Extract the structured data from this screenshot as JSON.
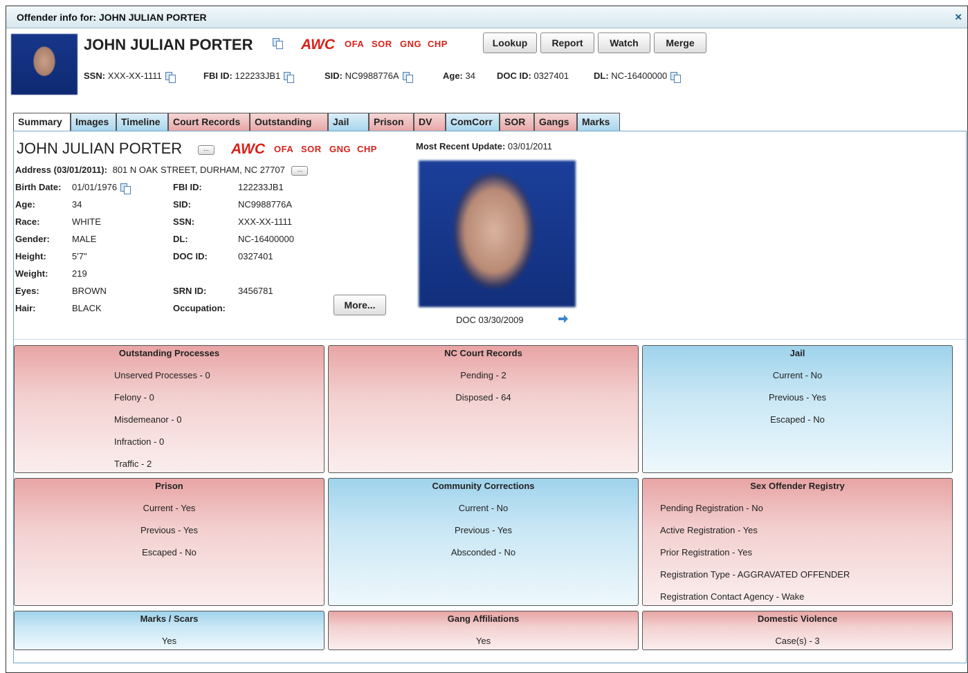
{
  "window": {
    "title": "Offender info for: JOHN JULIAN PORTER",
    "close_label": "×"
  },
  "header": {
    "name": "JOHN JULIAN PORTER",
    "flags": [
      "AWC",
      "OFA",
      "SOR",
      "GNG",
      "CHP"
    ],
    "buttons": [
      "Lookup",
      "Report",
      "Watch",
      "Merge"
    ],
    "ids": [
      {
        "label": "SSN:",
        "value": "XXX-XX-1111"
      },
      {
        "label": "FBI ID:",
        "value": "122233JB1"
      },
      {
        "label": "SID:",
        "value": "NC9988776A"
      },
      {
        "label": "Age:",
        "value": "34"
      },
      {
        "label": "DOC ID:",
        "value": "0327401"
      },
      {
        "label": "DL:",
        "value": "NC-16400000"
      }
    ]
  },
  "tabs": [
    "Summary",
    "Images",
    "Timeline",
    "Court Records",
    "Outstanding",
    "Jail",
    "Prison",
    "DV",
    "ComCorr",
    "SOR",
    "Gangs",
    "Marks"
  ],
  "summary": {
    "name": "JOHN JULIAN PORTER",
    "address_label": "Address (03/01/2011):",
    "address": "801 N OAK STREET, DURHAM, NC 27707",
    "left_fields": [
      {
        "label": "Birth Date:",
        "value": "01/01/1976"
      },
      {
        "label": "Age:",
        "value": "34"
      },
      {
        "label": "Race:",
        "value": "WHITE"
      },
      {
        "label": "Gender:",
        "value": "MALE"
      },
      {
        "label": "Height:",
        "value": "5'7\""
      },
      {
        "label": "Weight:",
        "value": "219"
      },
      {
        "label": "Eyes:",
        "value": "BROWN"
      },
      {
        "label": "Hair:",
        "value": "BLACK"
      }
    ],
    "right_fields": [
      {
        "label": "FBI ID:",
        "value": "122233JB1"
      },
      {
        "label": "SID:",
        "value": "NC9988776A"
      },
      {
        "label": "SSN:",
        "value": "XXX-XX-1111"
      },
      {
        "label": "DL:",
        "value": "NC-16400000"
      },
      {
        "label": "DOC ID:",
        "value": "0327401"
      },
      {
        "label": "",
        "value": ""
      },
      {
        "label": "SRN ID:",
        "value": "3456781"
      },
      {
        "label": "Occupation:",
        "value": ""
      }
    ],
    "more_button": "More...",
    "recent_update_label": "Most Recent Update:",
    "recent_update": "03/01/2011",
    "photo_caption": "DOC 03/30/2009"
  },
  "boxes": [
    {
      "title": "Outstanding Processes",
      "color": "red",
      "lines": [
        "Unserved Processes - 0",
        "Felony - 0",
        "Misdemeanor - 0",
        "Infraction - 0",
        "Traffic - 2"
      ]
    },
    {
      "title": "NC Court Records",
      "color": "red",
      "lines": [
        "Pending - 2",
        "Disposed - 64"
      ]
    },
    {
      "title": "Jail",
      "color": "blue",
      "lines": [
        "Current - No",
        "Previous - Yes",
        "Escaped - No"
      ]
    },
    {
      "title": "Prison",
      "color": "red",
      "lines": [
        "Current - Yes",
        "Previous - Yes",
        "Escaped - No"
      ]
    },
    {
      "title": "Community Corrections",
      "color": "blue",
      "lines": [
        "Current - No",
        "Previous - Yes",
        "Absconded - No"
      ]
    },
    {
      "title": "Sex Offender Registry",
      "color": "red",
      "lines": [
        "Pending Registration - No",
        "Active Registration - Yes",
        "Prior Registration - Yes",
        "Registration Type - AGGRAVATED OFFENDER",
        "Registration Contact Agency - Wake"
      ]
    },
    {
      "title": "Marks / Scars",
      "color": "blue",
      "lines": [
        "Yes"
      ]
    },
    {
      "title": "Gang Affiliations",
      "color": "red",
      "lines": [
        "Yes"
      ]
    },
    {
      "title": "Domestic Violence",
      "color": "red",
      "lines": [
        "Case(s) - 3"
      ]
    }
  ],
  "colors": {
    "flag": "#d6211a",
    "red_box": "#e8a4a4",
    "blue_box": "#9fd3ec",
    "title_bar": "#d8e8f0"
  }
}
